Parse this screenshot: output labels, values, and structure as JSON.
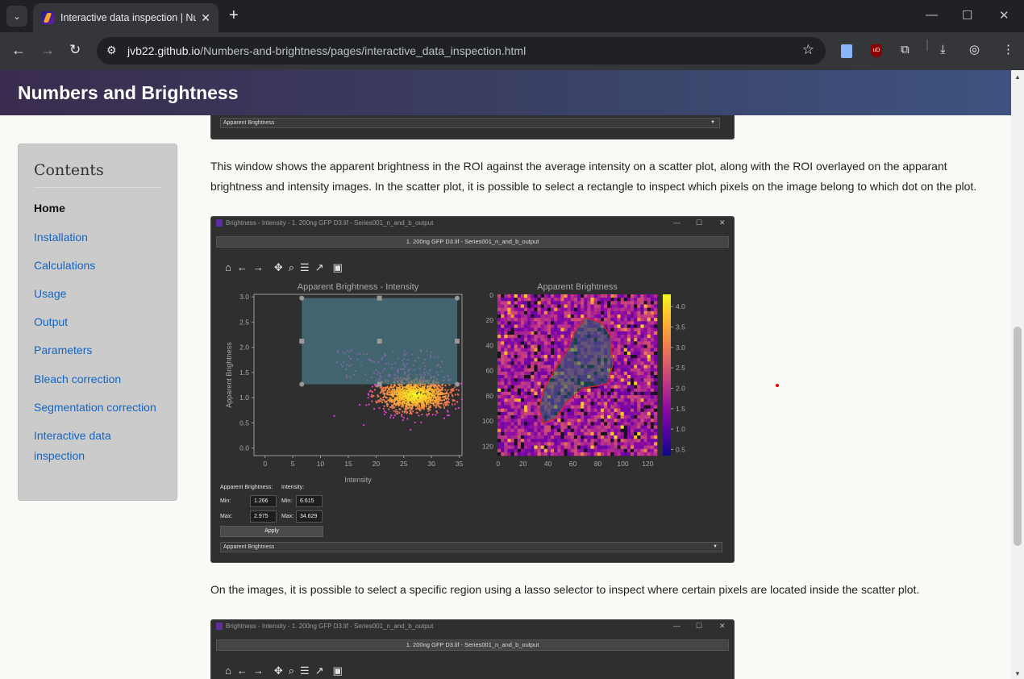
{
  "browser": {
    "tab_title": "Interactive data inspection | Numbers and Brightness",
    "url_host": "jvb22.github.io",
    "url_path": "/Numbers-and-brightness/pages/interactive_data_inspection.html"
  },
  "site": {
    "title": "Numbers and Brightness"
  },
  "sidebar": {
    "heading": "Contents",
    "items": [
      {
        "label": "Home"
      },
      {
        "label": "Installation"
      },
      {
        "label": "Calculations"
      },
      {
        "label": "Usage"
      },
      {
        "label": "Output"
      },
      {
        "label": "Parameters"
      },
      {
        "label": "Bleach correction"
      },
      {
        "label": "Segmentation correction"
      },
      {
        "label": "Interactive data inspection"
      }
    ]
  },
  "content": {
    "top_dropdown": "Apparent Brightness",
    "para1": "This window shows the apparent brightness in the ROI against the average intensity on a scatter plot, along with the ROI overlayed on the apparant brightness and intensity images. In the scatter plot, it is possible to select a rectangle to inspect which pixels on the image belong to which dot on the plot.",
    "para2": "On the images, it is possible to select a specific region using a lasso selector to inspect where certain pixels are located inside the scatter plot."
  },
  "screenshot1": {
    "window_title": "Brightness - Intensity - 1. 200ng GFP D3.lif - Series001_n_and_b_output",
    "file_bar": "1. 200ng GFP D3.lif - Series001_n_and_b_output",
    "form": {
      "ab_label": "Apparent Brightness:",
      "int_label": "Intensity:",
      "min_label": "Min:",
      "max_label": "Max:",
      "ab_min": "1.266",
      "ab_max": "2.975",
      "int_min": "6.615",
      "int_max": "34.629",
      "apply": "Apply",
      "dropdown": "Apparent Brightness"
    }
  },
  "screenshot2": {
    "window_title": "Brightness - Intensity - 1. 200ng GFP D3.lif - Series001_n_and_b_output",
    "file_bar": "1. 200ng GFP D3.lif - Series001_n_and_b_output"
  },
  "chart_data": [
    {
      "type": "scatter",
      "title": "Apparent Brightness - Intensity",
      "xlabel": "Intensity",
      "ylabel": "Apparent Brightness",
      "xlim": [
        -2,
        35.5
      ],
      "ylim": [
        -0.15,
        3.05
      ],
      "xticks": [
        0,
        5,
        10,
        15,
        20,
        25,
        30,
        35
      ],
      "yticks": [
        0.0,
        0.5,
        1.0,
        1.5,
        2.0,
        2.5,
        3.0
      ],
      "cluster_center": {
        "x": 27,
        "y": 1.05
      },
      "selection_rect": {
        "x": [
          6.615,
          34.629
        ],
        "y": [
          1.266,
          2.975
        ]
      }
    },
    {
      "type": "heatmap",
      "title": "Apparent Brightness",
      "xticks": [
        0,
        20,
        40,
        60,
        80,
        100,
        120
      ],
      "yticks": [
        0,
        20,
        40,
        60,
        80,
        100,
        120
      ],
      "colorbar_ticks": [
        0.5,
        1.0,
        1.5,
        2.0,
        2.5,
        3.0,
        3.5,
        4.0
      ],
      "colormap": "plasma"
    }
  ]
}
